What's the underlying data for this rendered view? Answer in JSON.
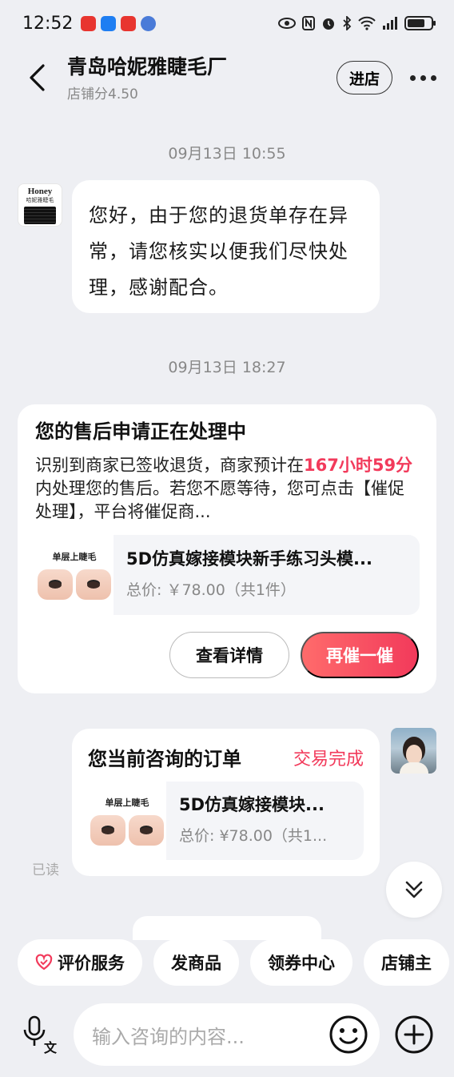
{
  "status_bar": {
    "time": "12:52",
    "app_icons": [
      {
        "name": "app-icon-red",
        "color": "#e8352f"
      },
      {
        "name": "app-icon-blue",
        "color": "#1e7ef2"
      },
      {
        "name": "app-icon-red-2",
        "color": "#e8352f"
      },
      {
        "name": "app-icon-music",
        "color": "#4a7bd8"
      }
    ],
    "battery_level": 0.75
  },
  "header": {
    "shop_name": "青岛哈妮雅睫毛厂",
    "shop_score": "店铺分4.50",
    "enter_label": "进店"
  },
  "conversation": {
    "timestamp_1": "09月13日 10:55",
    "merchant_message": "您好，由于您的退货单存在异常，请您核实以便我们尽快处理，感谢配合。",
    "shop_logo": {
      "brand": "Honey",
      "sub": "哈妮雅睫毛"
    },
    "timestamp_2": "09月13日 18:27"
  },
  "aftersale_card": {
    "title": "您的售后申请正在处理中",
    "body_prefix": "识别到商家已签收退货，商家预计在",
    "body_highlight": "167小时59分",
    "body_suffix": "内处理您的售后。若您不愿等待，您可点击【催促处理】，平台将催促商...",
    "product_thumb_label": "单层上睫毛",
    "product_title": "5D仿真嫁接模块新手练习头模...",
    "product_price": "总价: ￥78.00（共1件）",
    "detail_button": "查看详情",
    "urge_button": "再催一催"
  },
  "order_bubble": {
    "title": "您当前咨询的订单",
    "status": "交易完成",
    "product_thumb_label": "单层上睫毛",
    "product_title": "5D仿真嫁接模块...",
    "product_price": "总价: ¥78.00（共1..."
  },
  "read_label": "已读",
  "quick_actions": [
    "评价服务",
    "发商品",
    "领券中心",
    "店铺主"
  ],
  "input": {
    "placeholder": "输入咨询的内容..."
  },
  "colors": {
    "accent": "#f23a5b",
    "background": "#eeeff3"
  }
}
